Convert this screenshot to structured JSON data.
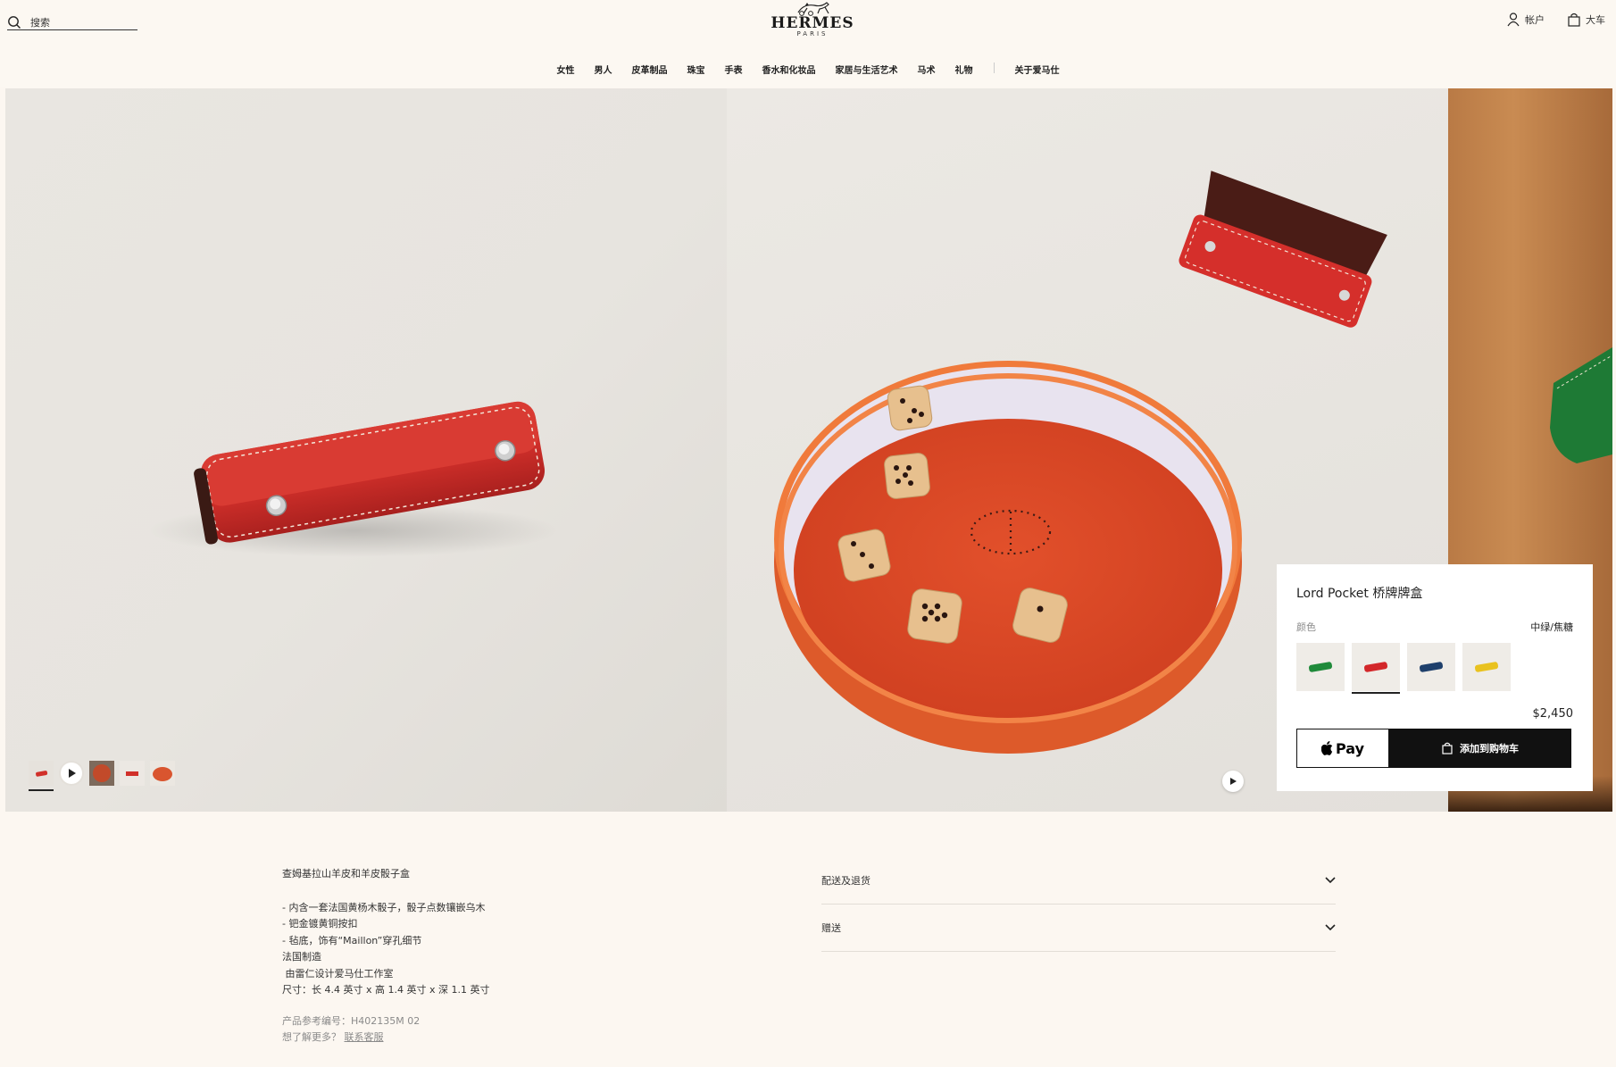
{
  "header": {
    "search_placeholder": "搜索",
    "brand": "HERMES",
    "brand_city": "PARIS",
    "account_label": "帐户",
    "cart_label": "大车"
  },
  "nav": [
    "女性",
    "男人",
    "皮革制品",
    "珠宝",
    "手表",
    "香水和化妆品",
    "家居与生活艺术",
    "马术",
    "礼物"
  ],
  "nav_extra": "关于爱马仕",
  "gallery": {
    "thumbnails": [
      {
        "name": "thumb-red-case",
        "active": true
      },
      {
        "name": "thumb-video",
        "active": false
      },
      {
        "name": "thumb-dice-tray",
        "active": false
      },
      {
        "name": "thumb-case-flat",
        "active": false
      },
      {
        "name": "thumb-tray-top",
        "active": false
      }
    ]
  },
  "product": {
    "title": "Lord Pocket 桥牌牌盒",
    "color_label": "颜色",
    "color_value": "中绿/焦糖",
    "colors": [
      {
        "name": "green",
        "hex": "#1f8a3a"
      },
      {
        "name": "red",
        "hex": "#d3272a",
        "selected": true
      },
      {
        "name": "navy",
        "hex": "#1e3f6b"
      },
      {
        "name": "yellow",
        "hex": "#e9c21f"
      }
    ],
    "price": "$2,450",
    "apple_pay_label": "Pay",
    "add_to_cart_label": "添加到购物车"
  },
  "description": {
    "heading": "查姆基拉山羊皮和羊皮骰子盒",
    "lines": [
      "- 内含一套法国黄杨木骰子，骰子点数镶嵌乌木",
      "- 钯金镀黄铜按扣",
      "- 毡底，饰有“Maillon”穿孔细节",
      "法国制造",
      " 由雷仁设计爱马仕工作室",
      "尺寸：长 4.4 英寸 x 高 1.4 英寸 x 深 1.1 英寸"
    ],
    "ref": "产品参考编号：H402135M 02",
    "more_prefix": "想了解更多？",
    "more_link": "联系客服"
  },
  "accordion": [
    "配送及退货",
    "赠送"
  ]
}
